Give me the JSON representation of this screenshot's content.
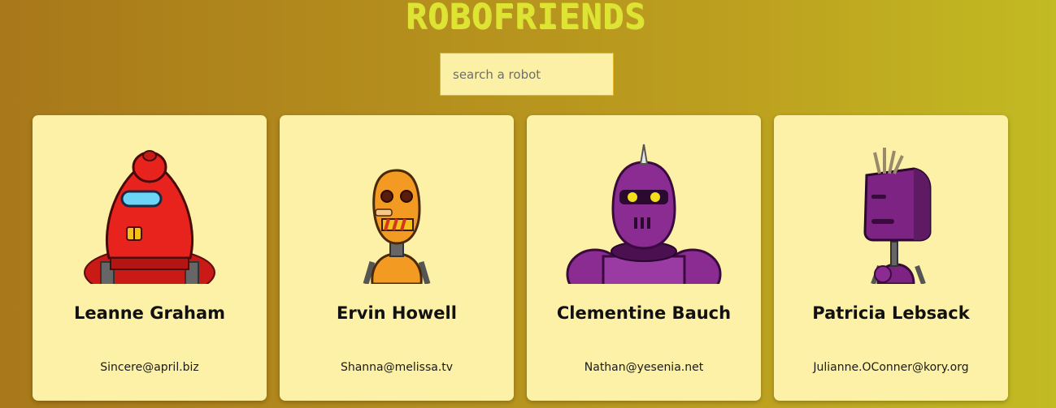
{
  "header": {
    "title": "ROBOFRIENDS"
  },
  "search": {
    "placeholder": "search a robot",
    "value": ""
  },
  "robots": [
    {
      "name": "Leanne Graham",
      "email": "Sincere@april.biz",
      "color": "#e8231e"
    },
    {
      "name": "Ervin Howell",
      "email": "Shanna@melissa.tv",
      "color": "#f29a22"
    },
    {
      "name": "Clementine Bauch",
      "email": "Nathan@yesenia.net",
      "color": "#8b2c93"
    },
    {
      "name": "Patricia Lebsack",
      "email": "Julianne.OConner@kory.org",
      "color": "#7d2383"
    }
  ]
}
